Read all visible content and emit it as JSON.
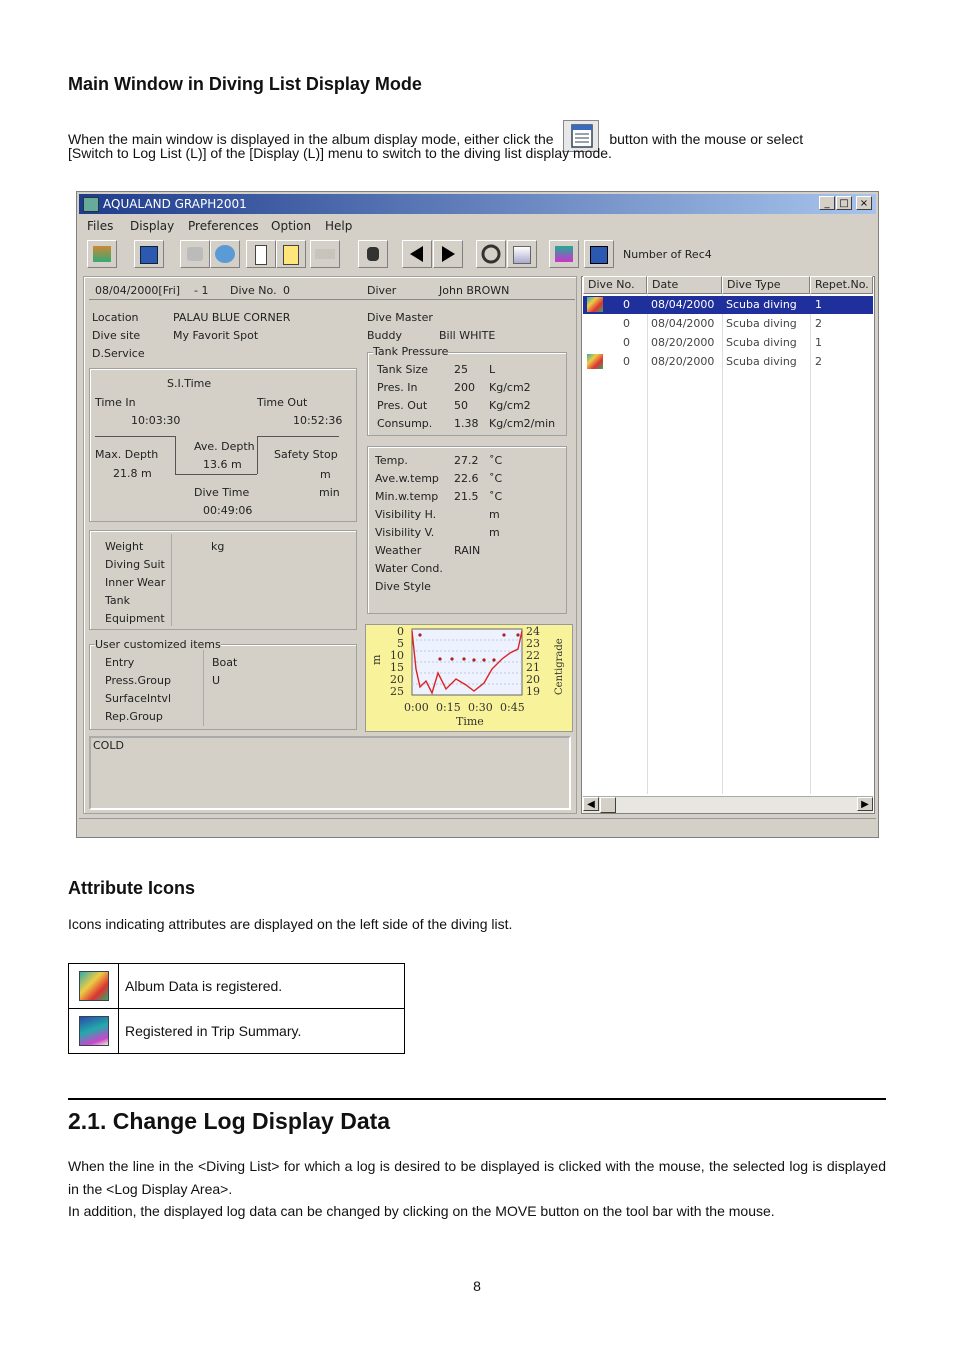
{
  "section1": {
    "heading": "Main Window in Diving List Display Mode",
    "para_a": "When the main window is displayed in the album display mode, either click the",
    "para_b": "button with the mouse or select",
    "para_line2": "[Switch to Log List (L)] of the [Display (L)] menu to switch to the diving list display mode."
  },
  "window": {
    "title": "AQUALAND GRAPH2001",
    "min": "_",
    "max": "□",
    "close": "×",
    "menus": [
      "Files",
      "Display",
      "Preferences",
      "Option",
      "Help"
    ],
    "number_label": "Number of Rec4",
    "log": {
      "date": "08/04/2000[Fri]",
      "seq": "- 1",
      "dive_no_label": "Dive No.",
      "dive_no": "0",
      "diver_label": "Diver",
      "diver": "John BROWN",
      "location_label": "Location",
      "location": "PALAU BLUE CORNER",
      "site_label": "Dive site",
      "site": "My Favorit Spot",
      "dservice_label": "D.Service",
      "divemaster_label": "Dive Master",
      "buddy_label": "Buddy",
      "buddy": "Bill WHITE",
      "tank_pressure_label": "Tank Pressure",
      "tank": [
        {
          "label": "Tank Size",
          "value": "25",
          "unit": "L"
        },
        {
          "label": "Pres. In",
          "value": "200",
          "unit": "Kg/cm2"
        },
        {
          "label": "Pres. Out",
          "value": "50",
          "unit": "Kg/cm2"
        },
        {
          "label": "Consump.",
          "value": "1.38",
          "unit": "Kg/cm2/min"
        }
      ],
      "si_time_label": "S.I.Time",
      "time_in_label": "Time In",
      "time_in": "10:03:30",
      "time_out_label": "Time Out",
      "time_out": "10:52:36",
      "max_depth_label": "Max. Depth",
      "max_depth": "21.8 m",
      "ave_depth_label": "Ave. Depth",
      "ave_depth": "13.6 m",
      "safety_label": "Safety Stop",
      "safety_m": "m",
      "safety_min": "min",
      "dive_time_label": "Dive Time",
      "dive_time": "00:49:06",
      "cond": [
        {
          "label": "Temp.",
          "value": "27.2",
          "unit": "˚C"
        },
        {
          "label": "Ave.w.temp",
          "value": "22.6",
          "unit": "˚C"
        },
        {
          "label": "Min.w.temp",
          "value": "21.5",
          "unit": "˚C"
        },
        {
          "label": "Visibility H.",
          "value": "",
          "unit": "m"
        },
        {
          "label": "Visibility V.",
          "value": "",
          "unit": "m"
        },
        {
          "label": "Weather",
          "value": "RAIN",
          "unit": ""
        },
        {
          "label": "Water Cond.",
          "value": "",
          "unit": ""
        },
        {
          "label": "Dive Style",
          "value": "",
          "unit": ""
        }
      ],
      "gear": [
        "Weight",
        "Diving Suit",
        "Inner Wear",
        "Tank",
        "Equipment"
      ],
      "weight_unit": "kg",
      "user_items_label": "User customized items",
      "user_items": [
        {
          "label": "Entry",
          "value": "Boat"
        },
        {
          "label": "Press.Group",
          "value": "U"
        },
        {
          "label": "SurfaceIntvl",
          "value": ""
        },
        {
          "label": "Rep.Group",
          "value": ""
        }
      ],
      "memo": "COLD"
    },
    "chart": {
      "left_ticks": [
        "0",
        "5",
        "10",
        "15",
        "20",
        "25"
      ],
      "right_ticks": [
        "24",
        "23",
        "22",
        "21",
        "20",
        "19"
      ],
      "x_ticks": [
        "0:00",
        "0:15",
        "0:30",
        "0:45"
      ],
      "xlabel": "Time",
      "ylabel_left": "m",
      "ylabel_right": "Centigrade"
    },
    "list": {
      "headers": [
        "Dive No.",
        "Date",
        "Dive Type",
        "Repet.No."
      ],
      "rows": [
        {
          "no": "0",
          "date": "08/04/2000",
          "type": "Scuba diving",
          "rep": "1"
        },
        {
          "no": "0",
          "date": "08/04/2000",
          "type": "Scuba diving",
          "rep": "2"
        },
        {
          "no": "0",
          "date": "08/20/2000",
          "type": "Scuba diving",
          "rep": "1"
        },
        {
          "no": "0",
          "date": "08/20/2000",
          "type": "Scuba diving",
          "rep": "2"
        }
      ]
    }
  },
  "section2": {
    "heading": "Attribute Icons",
    "para": "Icons indicating attributes are displayed on the left side of the diving list.",
    "rows": [
      "Album Data is registered.",
      "Registered in Trip Summary."
    ]
  },
  "section3": {
    "heading": "2.1. Change Log Display Data",
    "para1": "When the line in the <Diving List> for which a log is desired to be displayed is clicked with the mouse, the selected log is displayed in the <Log Display Area>.",
    "para2": "In addition, the displayed log data can be changed by clicking on the MOVE button on the tool bar with the mouse."
  },
  "page_number": "8"
}
